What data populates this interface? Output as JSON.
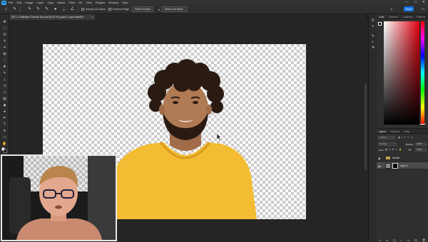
{
  "menubar": {
    "items": [
      "File",
      "Edit",
      "Image",
      "Layer",
      "Type",
      "Select",
      "Filter",
      "3D",
      "View",
      "Plugins",
      "Window",
      "Help"
    ],
    "window_controls": [
      "—",
      "□",
      "✕"
    ]
  },
  "options_bar": {
    "sample_all_layers_label": "Sample All Layers",
    "enhance_edge_label": "Enhance Edge",
    "select_subject_label": "Select Subject",
    "select_and_mask_label": "Select and Mask...",
    "share_label": "Share"
  },
  "document": {
    "tab_title": "DSC X Challenge 3 Version Doc.psd @ 26.7% (Layer 0, Layer Mask/8) *"
  },
  "panels": {
    "color_tabs": [
      "Color",
      "Swatches",
      "Gradients",
      "Patterns"
    ],
    "layers_tabs": [
      "Layers",
      "Channels",
      "Paths"
    ],
    "kind_label": "Kind",
    "mode_label": "Normal",
    "opacity_label": "Opacity:",
    "opacity_value": "100%",
    "lock_label": "Lock:",
    "fill_label": "Fill:",
    "fill_value": "100%",
    "layers": [
      {
        "name": "Header",
        "type": "group"
      },
      {
        "name": "Layer 0",
        "type": "masked"
      }
    ]
  },
  "colors": {
    "accent": "#1473e6",
    "shirt": "#f4bc32",
    "skin": "#b07a55",
    "hair": "#2a1a12"
  }
}
